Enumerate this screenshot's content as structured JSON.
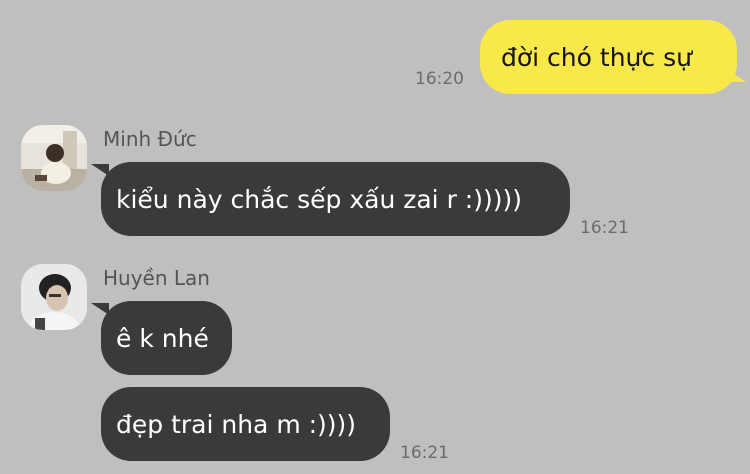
{
  "outgoing": {
    "message": "đời chó thực sự",
    "time": "16:20"
  },
  "group1": {
    "sender": "Minh Đức",
    "avatar_icon": "user-photo-minh-duc",
    "message": "kiểu này chắc sếp xấu zai r :)))))",
    "time": "16:21"
  },
  "group2": {
    "sender": "Huyền Lan",
    "avatar_icon": "user-photo-huyen-lan",
    "messages": [
      "ê k nhé",
      "đẹp trai nha m :))))"
    ],
    "time": "16:21"
  },
  "colors": {
    "background": "#bfbfbf",
    "outgoing_bubble": "#f9e84a",
    "incoming_bubble": "#3a3a3c",
    "incoming_text": "#ffffff",
    "timestamp": "#6b6b6b"
  }
}
